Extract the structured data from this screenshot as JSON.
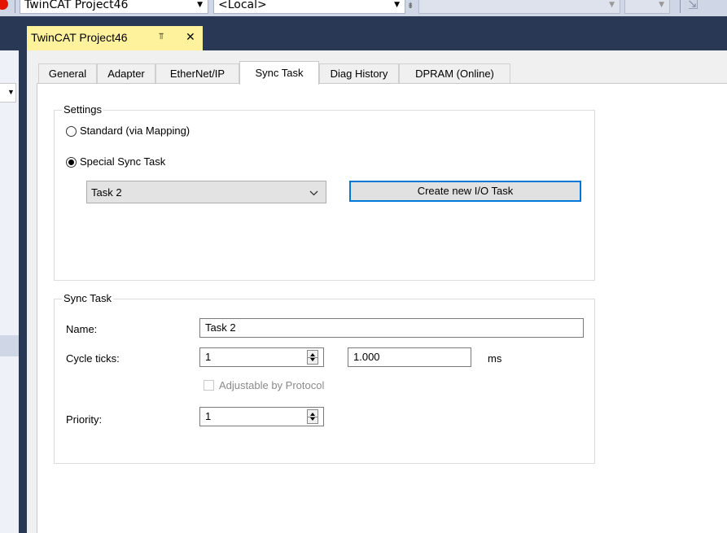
{
  "toolbar": {
    "solution_combo": "TwinCAT Project46",
    "target_combo": "<Local>"
  },
  "document_tab": {
    "title": "TwinCAT Project46",
    "pin_glyph": "⫪",
    "close_glyph": "✕"
  },
  "property_tabs": [
    {
      "label": "General"
    },
    {
      "label": "Adapter"
    },
    {
      "label": "EtherNet/IP"
    },
    {
      "label": "Sync Task",
      "active": true
    },
    {
      "label": "Diag History"
    },
    {
      "label": "DPRAM (Online)"
    }
  ],
  "settings": {
    "legend": "Settings",
    "option_standard": "Standard (via Mapping)",
    "option_special": "Special Sync Task",
    "selected": "special",
    "task_select_value": "Task 2",
    "create_button": "Create new I/O Task"
  },
  "sync_task": {
    "legend": "Sync Task",
    "name_label": "Name:",
    "name_value": "Task 2",
    "cycle_label": "Cycle ticks:",
    "cycle_value": "1",
    "cycle_ms_value": "1.000",
    "ms_unit": "ms",
    "adjustable_label": "Adjustable by Protocol",
    "adjustable_checked": false,
    "priority_label": "Priority:",
    "priority_value": "1"
  },
  "colors": {
    "ide_frame": "#293955",
    "doc_tab_active": "#fff29d",
    "button_border": "#0078d7"
  }
}
